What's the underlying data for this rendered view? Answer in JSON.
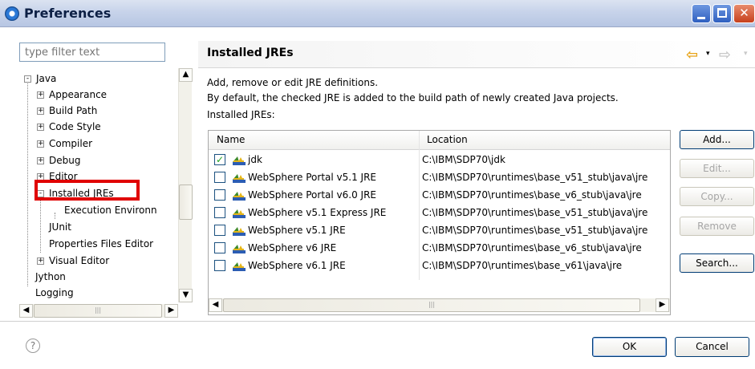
{
  "window": {
    "title": "Preferences"
  },
  "filter": {
    "placeholder": "type filter text"
  },
  "tree": {
    "items": [
      {
        "label": "Java",
        "expander": "-"
      },
      {
        "label": "Appearance",
        "expander": "+"
      },
      {
        "label": "Build Path",
        "expander": "+"
      },
      {
        "label": "Code Style",
        "expander": "+"
      },
      {
        "label": "Compiler",
        "expander": "+"
      },
      {
        "label": "Debug",
        "expander": "+"
      },
      {
        "label": "Editor",
        "expander": "+"
      },
      {
        "label": "Installed JREs",
        "expander": "-"
      },
      {
        "label": "Execution Environn",
        "expander": ""
      },
      {
        "label": "JUnit",
        "expander": ""
      },
      {
        "label": "Properties Files Editor",
        "expander": ""
      },
      {
        "label": "Visual Editor",
        "expander": "+"
      },
      {
        "label": "Jython",
        "expander": ""
      },
      {
        "label": "Logging",
        "expander": ""
      }
    ]
  },
  "page": {
    "title": "Installed JREs",
    "desc1": "Add, remove or edit JRE definitions.",
    "desc2": "By default, the checked JRE is added to the build path of newly created Java projects.",
    "list_label": "Installed JREs:"
  },
  "table": {
    "columns": [
      "Name",
      "Location"
    ],
    "rows": [
      {
        "name": "jdk",
        "location": "C:\\IBM\\SDP70\\jdk",
        "checked": true
      },
      {
        "name": "WebSphere Portal v5.1 JRE",
        "location": "C:\\IBM\\SDP70\\runtimes\\base_v51_stub\\java\\jre",
        "checked": false
      },
      {
        "name": "WebSphere Portal v6.0 JRE",
        "location": "C:\\IBM\\SDP70\\runtimes\\base_v6_stub\\java\\jre",
        "checked": false
      },
      {
        "name": "WebSphere v5.1 Express JRE",
        "location": "C:\\IBM\\SDP70\\runtimes\\base_v51_stub\\java\\jre",
        "checked": false
      },
      {
        "name": "WebSphere v5.1 JRE",
        "location": "C:\\IBM\\SDP70\\runtimes\\base_v51_stub\\java\\jre",
        "checked": false
      },
      {
        "name": "WebSphere v6 JRE",
        "location": "C:\\IBM\\SDP70\\runtimes\\base_v6_stub\\java\\jre",
        "checked": false
      },
      {
        "name": "WebSphere v6.1 JRE",
        "location": "C:\\IBM\\SDP70\\runtimes\\base_v61\\java\\jre",
        "checked": false
      }
    ],
    "check_glyph": "✓"
  },
  "buttons": {
    "add": "Add...",
    "edit": "Edit...",
    "copy": "Copy...",
    "remove": "Remove",
    "search": "Search...",
    "ok": "OK",
    "cancel": "Cancel"
  },
  "icons": {
    "help": "?",
    "back": "⇦",
    "forward": "⇨",
    "dropdown": "▾",
    "scroll_up": "▲",
    "scroll_down": "▼",
    "scroll_left": "◀",
    "scroll_right": "▶",
    "grip": "|||"
  },
  "colors": {
    "highlight": "#e00000",
    "jre_green": "#3f8a2a",
    "jre_yellow": "#e5b61a",
    "jre_blue": "#2c5db3"
  }
}
